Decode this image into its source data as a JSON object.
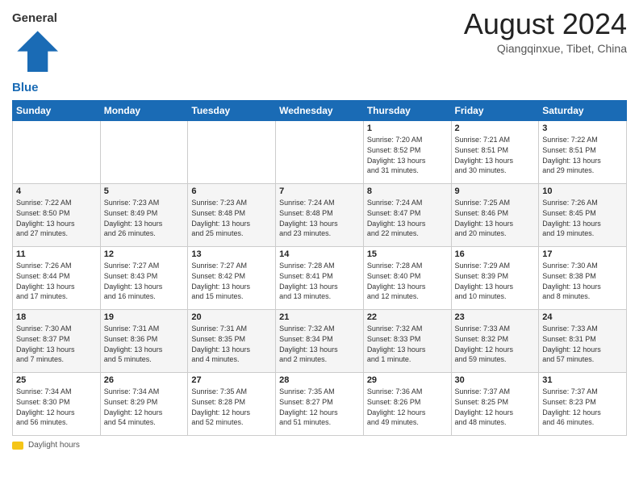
{
  "header": {
    "logo_general": "General",
    "logo_blue": "Blue",
    "month_year": "August 2024",
    "location": "Qiangqinxue, Tibet, China"
  },
  "days_of_week": [
    "Sunday",
    "Monday",
    "Tuesday",
    "Wednesday",
    "Thursday",
    "Friday",
    "Saturday"
  ],
  "footer": {
    "legend_label": "Daylight hours"
  },
  "weeks": [
    {
      "days": [
        {
          "number": "",
          "detail": ""
        },
        {
          "number": "",
          "detail": ""
        },
        {
          "number": "",
          "detail": ""
        },
        {
          "number": "",
          "detail": ""
        },
        {
          "number": "1",
          "detail": "Sunrise: 7:20 AM\nSunset: 8:52 PM\nDaylight: 13 hours\nand 31 minutes."
        },
        {
          "number": "2",
          "detail": "Sunrise: 7:21 AM\nSunset: 8:51 PM\nDaylight: 13 hours\nand 30 minutes."
        },
        {
          "number": "3",
          "detail": "Sunrise: 7:22 AM\nSunset: 8:51 PM\nDaylight: 13 hours\nand 29 minutes."
        }
      ]
    },
    {
      "days": [
        {
          "number": "4",
          "detail": "Sunrise: 7:22 AM\nSunset: 8:50 PM\nDaylight: 13 hours\nand 27 minutes."
        },
        {
          "number": "5",
          "detail": "Sunrise: 7:23 AM\nSunset: 8:49 PM\nDaylight: 13 hours\nand 26 minutes."
        },
        {
          "number": "6",
          "detail": "Sunrise: 7:23 AM\nSunset: 8:48 PM\nDaylight: 13 hours\nand 25 minutes."
        },
        {
          "number": "7",
          "detail": "Sunrise: 7:24 AM\nSunset: 8:48 PM\nDaylight: 13 hours\nand 23 minutes."
        },
        {
          "number": "8",
          "detail": "Sunrise: 7:24 AM\nSunset: 8:47 PM\nDaylight: 13 hours\nand 22 minutes."
        },
        {
          "number": "9",
          "detail": "Sunrise: 7:25 AM\nSunset: 8:46 PM\nDaylight: 13 hours\nand 20 minutes."
        },
        {
          "number": "10",
          "detail": "Sunrise: 7:26 AM\nSunset: 8:45 PM\nDaylight: 13 hours\nand 19 minutes."
        }
      ]
    },
    {
      "days": [
        {
          "number": "11",
          "detail": "Sunrise: 7:26 AM\nSunset: 8:44 PM\nDaylight: 13 hours\nand 17 minutes."
        },
        {
          "number": "12",
          "detail": "Sunrise: 7:27 AM\nSunset: 8:43 PM\nDaylight: 13 hours\nand 16 minutes."
        },
        {
          "number": "13",
          "detail": "Sunrise: 7:27 AM\nSunset: 8:42 PM\nDaylight: 13 hours\nand 15 minutes."
        },
        {
          "number": "14",
          "detail": "Sunrise: 7:28 AM\nSunset: 8:41 PM\nDaylight: 13 hours\nand 13 minutes."
        },
        {
          "number": "15",
          "detail": "Sunrise: 7:28 AM\nSunset: 8:40 PM\nDaylight: 13 hours\nand 12 minutes."
        },
        {
          "number": "16",
          "detail": "Sunrise: 7:29 AM\nSunset: 8:39 PM\nDaylight: 13 hours\nand 10 minutes."
        },
        {
          "number": "17",
          "detail": "Sunrise: 7:30 AM\nSunset: 8:38 PM\nDaylight: 13 hours\nand 8 minutes."
        }
      ]
    },
    {
      "days": [
        {
          "number": "18",
          "detail": "Sunrise: 7:30 AM\nSunset: 8:37 PM\nDaylight: 13 hours\nand 7 minutes."
        },
        {
          "number": "19",
          "detail": "Sunrise: 7:31 AM\nSunset: 8:36 PM\nDaylight: 13 hours\nand 5 minutes."
        },
        {
          "number": "20",
          "detail": "Sunrise: 7:31 AM\nSunset: 8:35 PM\nDaylight: 13 hours\nand 4 minutes."
        },
        {
          "number": "21",
          "detail": "Sunrise: 7:32 AM\nSunset: 8:34 PM\nDaylight: 13 hours\nand 2 minutes."
        },
        {
          "number": "22",
          "detail": "Sunrise: 7:32 AM\nSunset: 8:33 PM\nDaylight: 13 hours\nand 1 minute."
        },
        {
          "number": "23",
          "detail": "Sunrise: 7:33 AM\nSunset: 8:32 PM\nDaylight: 12 hours\nand 59 minutes."
        },
        {
          "number": "24",
          "detail": "Sunrise: 7:33 AM\nSunset: 8:31 PM\nDaylight: 12 hours\nand 57 minutes."
        }
      ]
    },
    {
      "days": [
        {
          "number": "25",
          "detail": "Sunrise: 7:34 AM\nSunset: 8:30 PM\nDaylight: 12 hours\nand 56 minutes."
        },
        {
          "number": "26",
          "detail": "Sunrise: 7:34 AM\nSunset: 8:29 PM\nDaylight: 12 hours\nand 54 minutes."
        },
        {
          "number": "27",
          "detail": "Sunrise: 7:35 AM\nSunset: 8:28 PM\nDaylight: 12 hours\nand 52 minutes."
        },
        {
          "number": "28",
          "detail": "Sunrise: 7:35 AM\nSunset: 8:27 PM\nDaylight: 12 hours\nand 51 minutes."
        },
        {
          "number": "29",
          "detail": "Sunrise: 7:36 AM\nSunset: 8:26 PM\nDaylight: 12 hours\nand 49 minutes."
        },
        {
          "number": "30",
          "detail": "Sunrise: 7:37 AM\nSunset: 8:25 PM\nDaylight: 12 hours\nand 48 minutes."
        },
        {
          "number": "31",
          "detail": "Sunrise: 7:37 AM\nSunset: 8:23 PM\nDaylight: 12 hours\nand 46 minutes."
        }
      ]
    }
  ]
}
